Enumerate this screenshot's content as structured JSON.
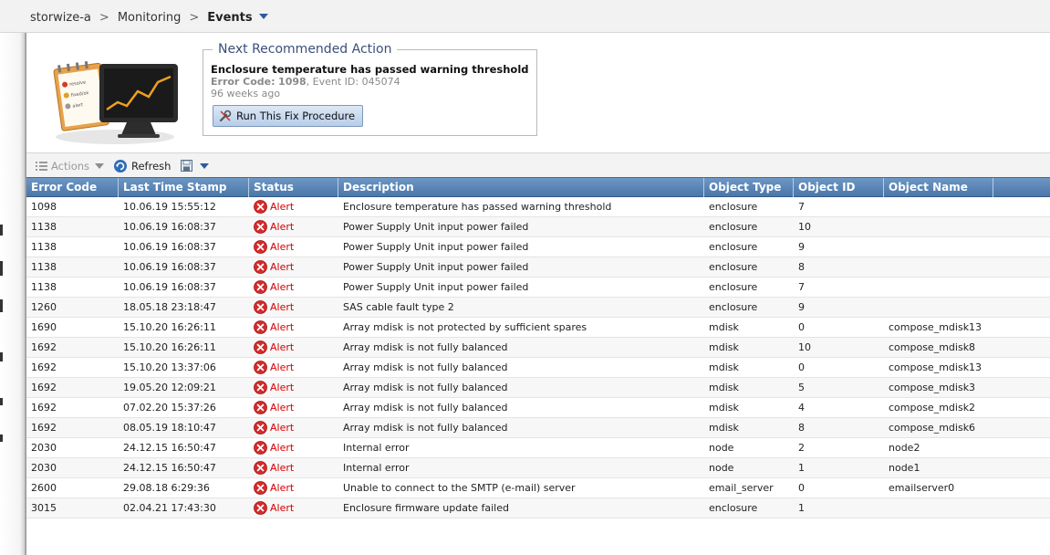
{
  "breadcrumb": {
    "items": [
      "storwize-a",
      "Monitoring",
      "Events"
    ],
    "separator": ">"
  },
  "recommended": {
    "legend": "Next Recommended Action",
    "title": "Enclosure temperature has passed warning threshold",
    "error_code_label": "Error Code:",
    "error_code": "1098",
    "event_id_text": ", Event ID: 045074",
    "age": "96 weeks ago",
    "fix_button": "Run This Fix Procedure",
    "hero_doc_lines": [
      "resolve",
      "fixed/ok",
      "alert"
    ]
  },
  "toolbar": {
    "actions": "Actions",
    "refresh": "Refresh"
  },
  "table": {
    "columns": [
      "Error Code",
      "Last Time Stamp",
      "Status",
      "Description",
      "Object Type",
      "Object ID",
      "Object Name"
    ],
    "rows": [
      {
        "code": "1098",
        "time": "10.06.19 15:55:12",
        "status": "Alert",
        "desc": "Enclosure temperature has passed warning threshold",
        "type": "enclosure",
        "id": "7",
        "name": ""
      },
      {
        "code": "1138",
        "time": "10.06.19 16:08:37",
        "status": "Alert",
        "desc": "Power Supply Unit input power failed",
        "type": "enclosure",
        "id": "10",
        "name": ""
      },
      {
        "code": "1138",
        "time": "10.06.19 16:08:37",
        "status": "Alert",
        "desc": "Power Supply Unit input power failed",
        "type": "enclosure",
        "id": "9",
        "name": ""
      },
      {
        "code": "1138",
        "time": "10.06.19 16:08:37",
        "status": "Alert",
        "desc": "Power Supply Unit input power failed",
        "type": "enclosure",
        "id": "8",
        "name": ""
      },
      {
        "code": "1138",
        "time": "10.06.19 16:08:37",
        "status": "Alert",
        "desc": "Power Supply Unit input power failed",
        "type": "enclosure",
        "id": "7",
        "name": ""
      },
      {
        "code": "1260",
        "time": "18.05.18 23:18:47",
        "status": "Alert",
        "desc": "SAS cable fault type 2",
        "type": "enclosure",
        "id": "9",
        "name": ""
      },
      {
        "code": "1690",
        "time": "15.10.20 16:26:11",
        "status": "Alert",
        "desc": "Array mdisk is not protected by sufficient spares",
        "type": "mdisk",
        "id": "0",
        "name": "compose_mdisk13"
      },
      {
        "code": "1692",
        "time": "15.10.20 16:26:11",
        "status": "Alert",
        "desc": "Array mdisk is not fully balanced",
        "type": "mdisk",
        "id": "10",
        "name": "compose_mdisk8"
      },
      {
        "code": "1692",
        "time": "15.10.20 13:37:06",
        "status": "Alert",
        "desc": "Array mdisk is not fully balanced",
        "type": "mdisk",
        "id": "0",
        "name": "compose_mdisk13"
      },
      {
        "code": "1692",
        "time": "19.05.20 12:09:21",
        "status": "Alert",
        "desc": "Array mdisk is not fully balanced",
        "type": "mdisk",
        "id": "5",
        "name": "compose_mdisk3"
      },
      {
        "code": "1692",
        "time": "07.02.20 15:37:26",
        "status": "Alert",
        "desc": "Array mdisk is not fully balanced",
        "type": "mdisk",
        "id": "4",
        "name": "compose_mdisk2"
      },
      {
        "code": "1692",
        "time": "08.05.19 18:10:47",
        "status": "Alert",
        "desc": "Array mdisk is not fully balanced",
        "type": "mdisk",
        "id": "8",
        "name": "compose_mdisk6"
      },
      {
        "code": "2030",
        "time": "24.12.15 16:50:47",
        "status": "Alert",
        "desc": "Internal error",
        "type": "node",
        "id": "2",
        "name": "node2"
      },
      {
        "code": "2030",
        "time": "24.12.15 16:50:47",
        "status": "Alert",
        "desc": "Internal error",
        "type": "node",
        "id": "1",
        "name": "node1"
      },
      {
        "code": "2600",
        "time": "29.08.18 6:29:36",
        "status": "Alert",
        "desc": "Unable to connect to the SMTP (e-mail) server",
        "type": "email_server",
        "id": "0",
        "name": "emailserver0"
      },
      {
        "code": "3015",
        "time": "02.04.21 17:43:30",
        "status": "Alert",
        "desc": "Enclosure firmware update failed",
        "type": "enclosure",
        "id": "1",
        "name": ""
      }
    ]
  },
  "colors": {
    "header_top": "#6d97c4",
    "header_bottom": "#4a77a9",
    "alert_red": "#d40000",
    "link_blue": "#2a5b9f"
  }
}
